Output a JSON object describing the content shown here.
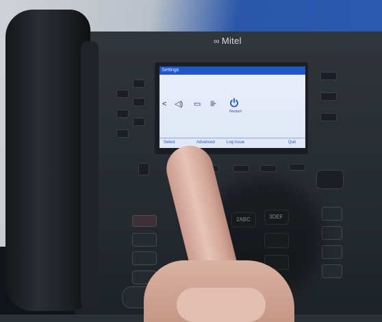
{
  "brand": {
    "logo_glyph": "∞",
    "name": "Mitel"
  },
  "screen": {
    "title": "Settings",
    "back_glyph": "<",
    "icons": [
      {
        "name": "audio-icon",
        "glyph": "◁)"
      },
      {
        "name": "display-icon",
        "glyph": "▭"
      },
      {
        "name": "network-icon",
        "glyph": "⊪"
      }
    ],
    "restart_label": "Restart",
    "softkeys": [
      "Select",
      "Advanced",
      "Log Issue",
      "Quit"
    ]
  },
  "keypad": {
    "labels": [
      "2ABC",
      "3DEF"
    ]
  },
  "colors": {
    "screen_title_bar": "#1f56c9",
    "screen_bg": "#e5ebf8",
    "icon": "#1b2c63"
  }
}
